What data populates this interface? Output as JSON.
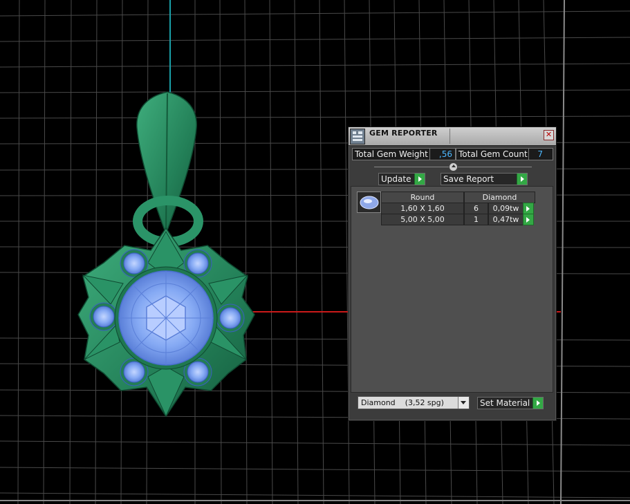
{
  "panel": {
    "title": "GEM REPORTER",
    "close_glyph": "✕",
    "title_icon": "gem-reporter-icon"
  },
  "summary": {
    "weight_label": "Total Gem Weight",
    "weight_value": ",56",
    "count_label": "Total Gem Count",
    "count_value": "7"
  },
  "actions": {
    "update_label": "Update",
    "save_label": "Save Report"
  },
  "table": {
    "headers": [
      "Round",
      "Diamond"
    ],
    "rows": [
      {
        "size": "1,60 X 1,60",
        "count": "6",
        "weight": "0,09tw"
      },
      {
        "size": "5,00 X 5,00",
        "count": "1",
        "weight": "0,47tw"
      }
    ]
  },
  "material": {
    "selected": "Diamond    (3,52 spg)",
    "set_label": "Set Material"
  },
  "colors": {
    "accent_green": "#33a845",
    "value_blue": "#4db8ff",
    "model_green": "#2e8f66",
    "gem_blue": "#8fb4ff"
  }
}
